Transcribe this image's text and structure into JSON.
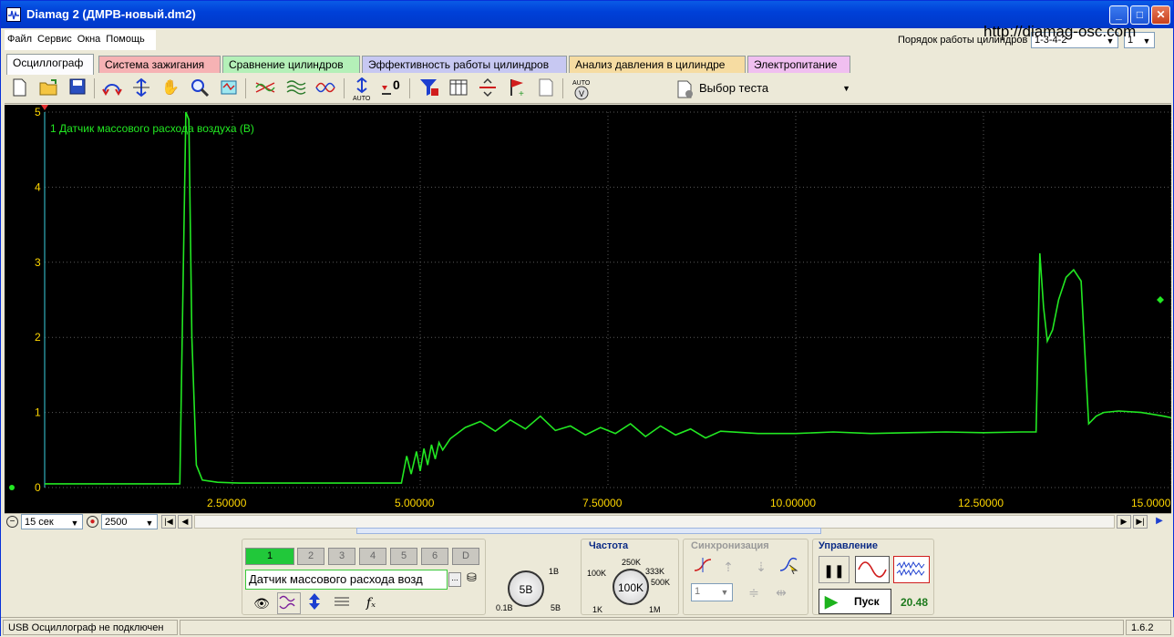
{
  "window": {
    "title": "Diamag 2 (ДМРВ-новый.dm2)",
    "url": "http://diamag-osc.com"
  },
  "menu": [
    "Файл",
    "Сервис",
    "Окна",
    "Помощь"
  ],
  "cylinder_order": {
    "label": "Порядок работы цилиндров",
    "value": "1-3-4-2",
    "second_value": "1"
  },
  "tabs": [
    {
      "label": "Осциллограф",
      "color": "#fcfcfe"
    },
    {
      "label": "Система зажигания",
      "color": "#f6b2b4"
    },
    {
      "label": "Сравнение цилиндров",
      "color": "#b4f0b8"
    },
    {
      "label": "Эффективность работы цилиндров",
      "color": "#c7c8f2"
    },
    {
      "label": "Анализ давления в цилиндре",
      "color": "#f6dca2"
    },
    {
      "label": "Электропитание",
      "color": "#f0bff0"
    }
  ],
  "toolbar": {
    "test_select": "Выбор теста",
    "icons": [
      "new-file-icon",
      "open-folder-icon",
      "save-icon",
      "horizontal-zoom-icon",
      "vertical-zoom-icon",
      "hand-icon",
      "magnifier-icon",
      "fit-icon",
      "cross-wave-icon",
      "wave-stack-icon",
      "wave-compare-icon",
      "auto-scale-icon",
      "zero-offset-icon",
      "filter-icon",
      "table-icon",
      "split-icon",
      "flag-icon",
      "note-icon",
      "auto-voltage-icon"
    ],
    "zero_label": "0",
    "auto_label": "AUTO"
  },
  "chart_data": {
    "type": "line",
    "series": [
      {
        "name": "1 Датчик массового расхода воздуха (В)",
        "color": "#22e822",
        "x": [
          0.0,
          1.8,
          1.88,
          1.92,
          1.96,
          2.02,
          2.1,
          2.3,
          2.6,
          4.6,
          4.75,
          4.82,
          4.88,
          4.95,
          5.0,
          5.05,
          5.1,
          5.15,
          5.2,
          5.25,
          5.3,
          5.4,
          5.6,
          5.8,
          6.0,
          6.2,
          6.4,
          6.6,
          6.8,
          7.0,
          7.2,
          7.4,
          7.6,
          7.8,
          8.0,
          8.2,
          8.4,
          8.6,
          8.8,
          9.0,
          9.5,
          10.0,
          10.5,
          11.0,
          11.5,
          12.0,
          12.5,
          13.0,
          13.2,
          13.25,
          13.3,
          13.35,
          13.42,
          13.5,
          13.6,
          13.7,
          13.8,
          13.85,
          13.9,
          14.0,
          14.1,
          14.3,
          14.6,
          14.9,
          15.0
        ],
        "y": [
          0.05,
          0.05,
          5.0,
          4.9,
          2.0,
          0.3,
          0.1,
          0.07,
          0.06,
          0.06,
          0.06,
          0.42,
          0.18,
          0.48,
          0.22,
          0.52,
          0.3,
          0.57,
          0.38,
          0.6,
          0.5,
          0.65,
          0.8,
          0.88,
          0.75,
          0.9,
          0.78,
          0.95,
          0.76,
          0.82,
          0.7,
          0.8,
          0.72,
          0.85,
          0.68,
          0.82,
          0.7,
          0.78,
          0.66,
          0.75,
          0.72,
          0.72,
          0.74,
          0.72,
          0.73,
          0.74,
          0.73,
          0.74,
          0.74,
          3.12,
          2.4,
          1.95,
          2.1,
          2.5,
          2.8,
          2.9,
          2.75,
          1.8,
          0.85,
          0.95,
          1.0,
          1.02,
          1.0,
          0.95,
          0.93
        ]
      }
    ],
    "xlim": [
      0,
      15
    ],
    "ylim": [
      0,
      5
    ],
    "x_ticks": [
      "2.50000",
      "5.00000",
      "7.50000",
      "10.00000",
      "12.50000",
      "15.0000"
    ],
    "x_tick_values": [
      2.5,
      5.0,
      7.5,
      10.0,
      12.5,
      15.0
    ],
    "y_ticks": [
      "0",
      "1",
      "2",
      "3",
      "4",
      "5"
    ],
    "y_tick_values": [
      0,
      1,
      2,
      3,
      4,
      5
    ],
    "grid": true,
    "legend": "top-left"
  },
  "hscroll": {
    "time_value": "15 сек",
    "points_value": "2500"
  },
  "channels": {
    "buttons": [
      "1",
      "2",
      "3",
      "4",
      "5",
      "6",
      "D"
    ],
    "sensor_name": "Датчик массового расхода возд",
    "more_label": "..."
  },
  "voltage_knob": {
    "value": "5В",
    "min_label": "0.1В",
    "max_label": "5В",
    "top_label": "1В"
  },
  "frequency": {
    "title": "Частота",
    "value": "100K",
    "labels": [
      "100K",
      "250K",
      "333K",
      "500K",
      "1K",
      "1M"
    ]
  },
  "sync": {
    "title": "Синхронизация",
    "value": "1"
  },
  "control": {
    "title": "Управление",
    "start_label": "Пуск",
    "fps": "20.48"
  },
  "status": {
    "text": "USB Осциллограф не подключен",
    "version": "1.6.2"
  }
}
